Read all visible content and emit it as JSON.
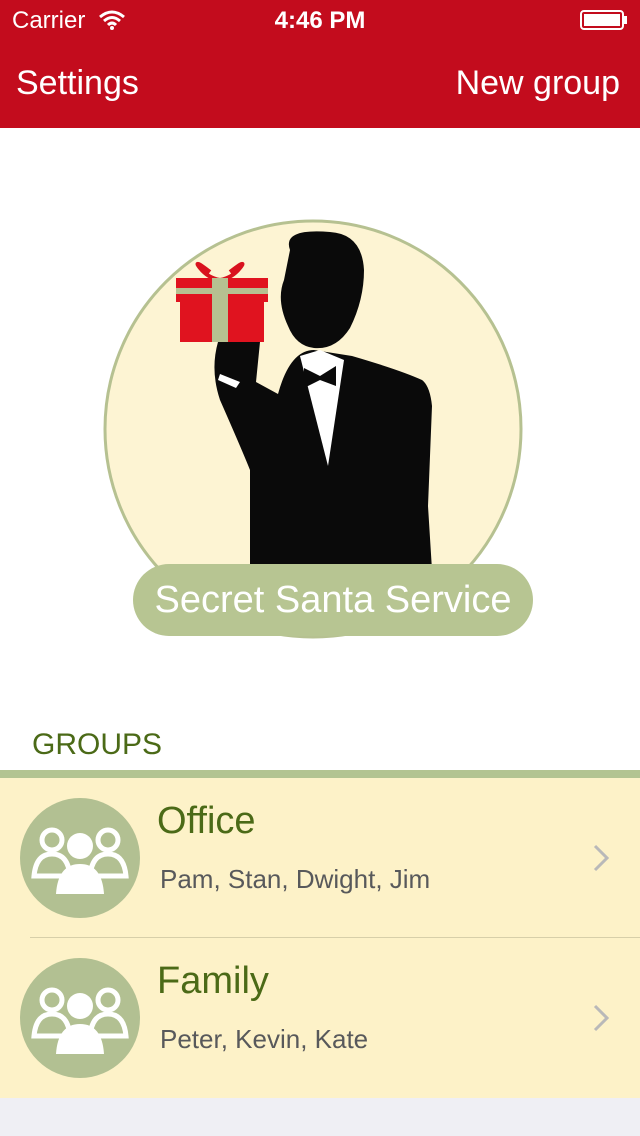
{
  "status_bar": {
    "carrier": "Carrier",
    "time": "4:46 PM"
  },
  "nav": {
    "left_label": "Settings",
    "right_label": "New group"
  },
  "logo": {
    "text": "Secret Santa Service"
  },
  "groups": {
    "title": "GROUPS",
    "items": [
      {
        "name": "Office",
        "members": "Pam, Stan, Dwight, Jim"
      },
      {
        "name": "Family",
        "members": "Peter, Kevin, Kate"
      }
    ]
  },
  "colors": {
    "nav_bar": "#c30c1d",
    "accent_green": "#b3c492",
    "text_green": "#4b6a17",
    "row_background": "#fdf2c8"
  }
}
